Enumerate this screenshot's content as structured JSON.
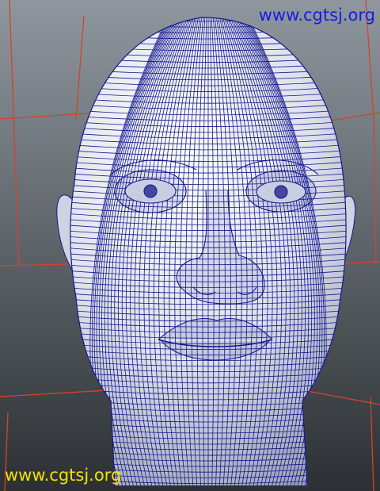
{
  "viewport": {
    "subject": "wireframe-head-mesh",
    "background_top": "#8f979e",
    "background_bottom": "#2c3034",
    "grid_color": "#d2442e",
    "wire_color": "#141a8c",
    "surface_color": "#dfe1ec"
  },
  "watermarks": {
    "top": {
      "text": "www.cgtsj.org",
      "color": "#1a1ae6"
    },
    "bottom": {
      "text": "www.cgtsj.org",
      "color": "#f2e200"
    }
  }
}
